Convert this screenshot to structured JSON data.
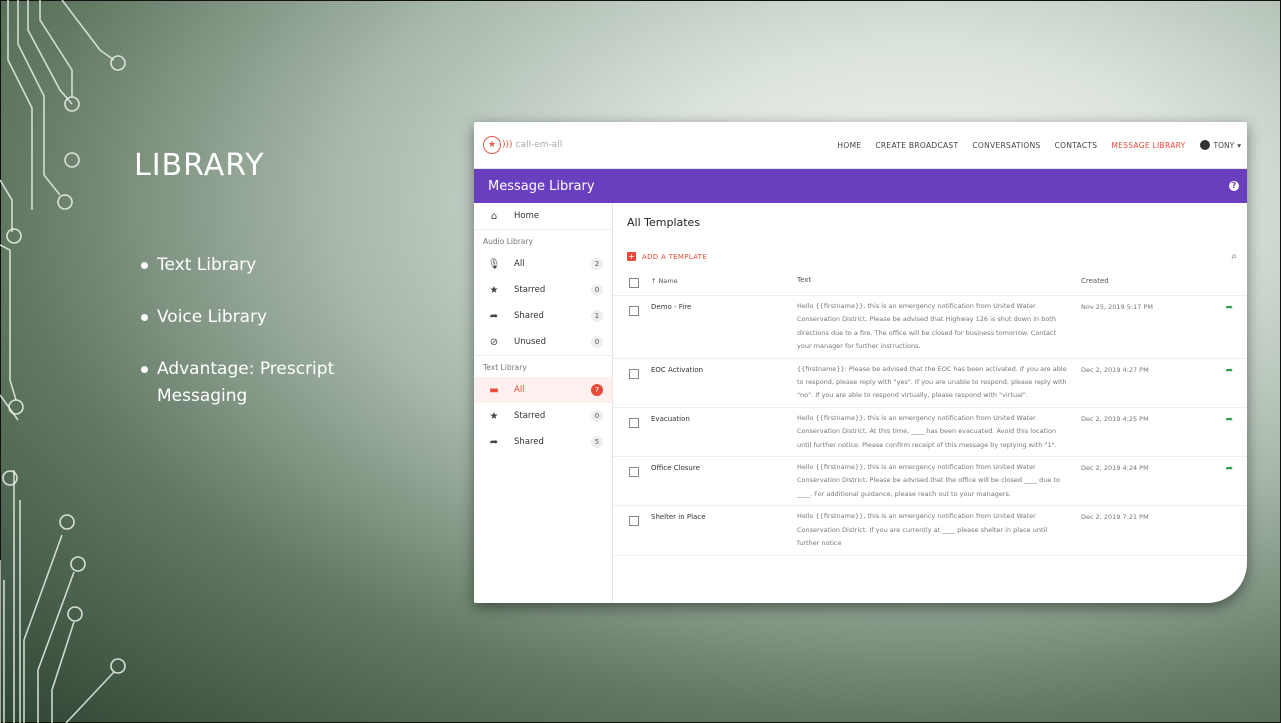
{
  "slide": {
    "title": "LIBRARY",
    "bullets": [
      "Text Library",
      "Voice Library",
      "Advantage: Prescript Messaging"
    ]
  },
  "app": {
    "brand": "call-em-all",
    "nav": [
      "HOME",
      "CREATE BROADCAST",
      "CONVERSATIONS",
      "CONTACTS",
      "MESSAGE LIBRARY"
    ],
    "active_nav": "MESSAGE LIBRARY",
    "user": "TONY",
    "header_title": "Message Library",
    "sidebar": {
      "home": "Home",
      "audio_head": "Audio Library",
      "audio": [
        {
          "label": "All",
          "count": "2"
        },
        {
          "label": "Starred",
          "count": "0"
        },
        {
          "label": "Shared",
          "count": "1"
        },
        {
          "label": "Unused",
          "count": "0"
        }
      ],
      "text_head": "Text Library",
      "text": [
        {
          "label": "All",
          "count": "7"
        },
        {
          "label": "Starred",
          "count": "0"
        },
        {
          "label": "Shared",
          "count": "5"
        }
      ]
    },
    "main": {
      "title": "All Templates",
      "add_label": "ADD A TEMPLATE",
      "columns": {
        "name": "Name",
        "text": "Text",
        "created": "Created"
      },
      "rows": [
        {
          "name": "Demo - Fire",
          "text": "Hello {{firstname}}, this is an emergency notification from United Water Conservation District. Please be advised that Highway 126 is shut down in both directions due to a fire. The office will be closed for business tomorrow. Contact your manager for further instructions.",
          "created": "Nov 25, 2019 5:17 PM"
        },
        {
          "name": "EOC Activation",
          "text": "{{firstname}}: Please be advised that the EOC has been activated. If you are able to respond, please reply with \"yes\". If you are unable to respond, please reply with \"no\". If you are able to respond virtually, please respond with \"virtual\".",
          "created": "Dec 2, 2019 4:27 PM"
        },
        {
          "name": "Evacuation",
          "text": "Hello {{firstname}}, this is an emergency notification from United Water Conservation District. At this time, ____ has been evacuated. Avoid this location until further notice. Please confirm receipt of this message by replying with \"1\".",
          "created": "Dec 2, 2019 4:25 PM"
        },
        {
          "name": "Office Closure",
          "text": "Hello {{firstname}}, this is an emergency notification from United Water Conservation District. Please be advised that the office will be closed ____ due to ____. For additional guidance, please reach out to your managers.",
          "created": "Dec 2, 2019 4:24 PM"
        },
        {
          "name": "Shelter in Place",
          "text": "Hello {{firstname}}, this is an emergency notification from United Water Conservation District. If you are currently at ____ please shelter in place until further notice",
          "created": "Dec 2, 2019 7:21 PM"
        }
      ]
    }
  }
}
